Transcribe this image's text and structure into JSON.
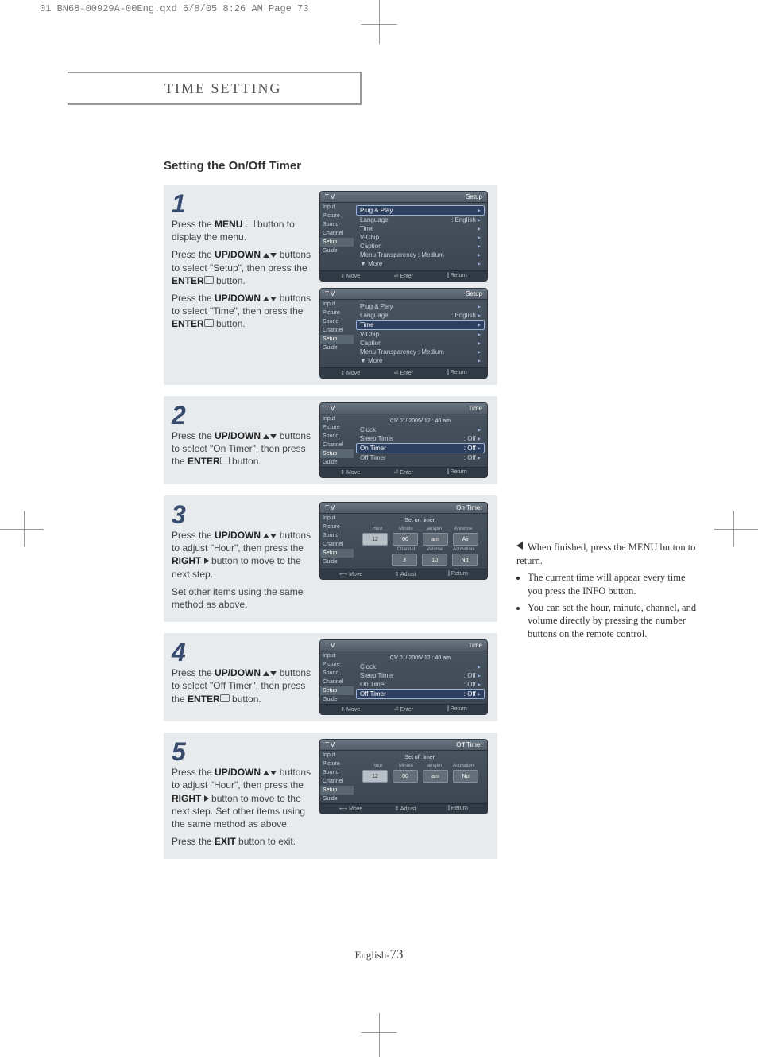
{
  "print_header": "01 BN68-00929A-00Eng.qxd  6/8/05 8:26 AM  Page 73",
  "section_title": "TIME SETTING",
  "sub_title": "Setting the On/Off Timer",
  "page_footer_prefix": "English-",
  "page_footer_num": "73",
  "side_note_lead": "When finished, press the MENU button to return.",
  "side_note_items": [
    "The current time will appear every time you press the INFO button.",
    "You can set the hour, minute, channel, and volume directly by pressing the number buttons on the remote control."
  ],
  "tv_side_items": [
    "Input",
    "Picture",
    "Sound",
    "Channel",
    "Setup",
    "Guide"
  ],
  "steps": [
    {
      "num": "1",
      "text_parts": [
        "Press the <b>MENU</b> <span class='icon-sm'></span> button to display the menu.",
        "Press the <b>UP/DOWN</b> <span class='tri-up'></span><span class='tri-down'></span> buttons to select \"Setup\", then press the <b>ENTER</b><span class='icon-sm'></span> button.",
        "Press the <b>UP/DOWN</b> <span class='tri-up'></span><span class='tri-down'></span> buttons to select \"Time\", then press the <b>ENTER</b><span class='icon-sm'></span> button."
      ],
      "screens": [
        {
          "title_left": "T V",
          "title_right": "Setup",
          "rows": [
            {
              "l": "Plug & Play",
              "r": "",
              "hl": true
            },
            {
              "l": "Language",
              "r": ": English"
            },
            {
              "l": "Time",
              "r": ""
            },
            {
              "l": "V-Chip",
              "r": ""
            },
            {
              "l": "Caption",
              "r": ""
            },
            {
              "l": "Menu Transparency : Medium",
              "r": ""
            },
            {
              "l": "▼ More",
              "r": ""
            }
          ],
          "footer": [
            "⇕ Move",
            "⏎ Enter",
            "⫿ Return"
          ]
        },
        {
          "title_left": "T V",
          "title_right": "Setup",
          "rows": [
            {
              "l": "Plug & Play",
              "r": ""
            },
            {
              "l": "Language",
              "r": ": English"
            },
            {
              "l": "Time",
              "r": "",
              "hl": true
            },
            {
              "l": "V-Chip",
              "r": ""
            },
            {
              "l": "Caption",
              "r": ""
            },
            {
              "l": "Menu Transparency : Medium",
              "r": ""
            },
            {
              "l": "▼ More",
              "r": ""
            }
          ],
          "footer": [
            "⇕ Move",
            "⏎ Enter",
            "⫿ Return"
          ]
        }
      ]
    },
    {
      "num": "2",
      "text_parts": [
        "Press the <b>UP/DOWN</b> <span class='tri-up'></span><span class='tri-down'></span> buttons to select \"On Timer\", then press the <b>ENTER</b><span class='icon-sm'></span> button."
      ],
      "screens": [
        {
          "title_left": "T V",
          "title_right": "Time",
          "pre_note": "01/ 01/ 2005/ 12 : 40 am",
          "rows": [
            {
              "l": "Clock",
              "r": ""
            },
            {
              "l": "Sleep Timer",
              "r": ": Off"
            },
            {
              "l": "On Timer",
              "r": ": Off",
              "hl": true
            },
            {
              "l": "Off Timer",
              "r": ": Off"
            }
          ],
          "footer": [
            "⇕ Move",
            "⏎ Enter",
            "⫿ Return"
          ]
        }
      ]
    },
    {
      "num": "3",
      "text_parts": [
        "Press the <b>UP/DOWN</b> <span class='tri-up'></span><span class='tri-down'></span> buttons to adjust \"Hour\", then press the <b>RIGHT</b> <span class='tri-right'></span> button to move to the next step.",
        "Set other items using the same method as above."
      ],
      "screens": [
        {
          "title_left": "T V",
          "title_right": "On Timer",
          "center_note": "Set on timer.",
          "param_groups": [
            {
              "labels": [
                "Hour",
                "Minute",
                "am/pm",
                "Antenna"
              ],
              "values": [
                "12",
                "00",
                "am",
                "Air"
              ],
              "big_first": true
            },
            {
              "labels": [
                "",
                "Channel",
                "Volume",
                "Activation"
              ],
              "values": [
                "",
                "3",
                "10",
                "No"
              ]
            }
          ],
          "footer": [
            "⟷ Move",
            "⇕ Adjust",
            "⫿ Return"
          ]
        }
      ]
    },
    {
      "num": "4",
      "text_parts": [
        "Press the <b>UP/DOWN</b> <span class='tri-up'></span><span class='tri-down'></span> buttons to select \"Off Timer\", then press the <b>ENTER</b><span class='icon-sm'></span> button."
      ],
      "screens": [
        {
          "title_left": "T V",
          "title_right": "Time",
          "pre_note": "01/ 01/ 2005/ 12 : 40 am",
          "rows": [
            {
              "l": "Clock",
              "r": ""
            },
            {
              "l": "Sleep Timer",
              "r": ": Off"
            },
            {
              "l": "On Timer",
              "r": ": Off"
            },
            {
              "l": "Off Timer",
              "r": ": Off",
              "hl": true
            }
          ],
          "footer": [
            "⇕ Move",
            "⏎ Enter",
            "⫿ Return"
          ]
        }
      ]
    },
    {
      "num": "5",
      "text_parts": [
        "Press the <b>UP/DOWN</b> <span class='tri-up'></span><span class='tri-down'></span> buttons to adjust \"Hour\", then press the <b>RIGHT</b> <span class='tri-right'></span> button to move to the next step. Set other items using the same method as above.",
        "Press the <b>EXIT</b> button to exit."
      ],
      "screens": [
        {
          "title_left": "T V",
          "title_right": "Off Timer",
          "center_note": "Set off timer.",
          "param_groups": [
            {
              "labels": [
                "Hour",
                "Minute",
                "am/pm",
                "Activation"
              ],
              "values": [
                "12",
                "00",
                "am",
                "No"
              ],
              "big_first": true
            }
          ],
          "footer": [
            "⟷ Move",
            "⇕ Adjust",
            "⫿ Return"
          ]
        }
      ]
    }
  ]
}
